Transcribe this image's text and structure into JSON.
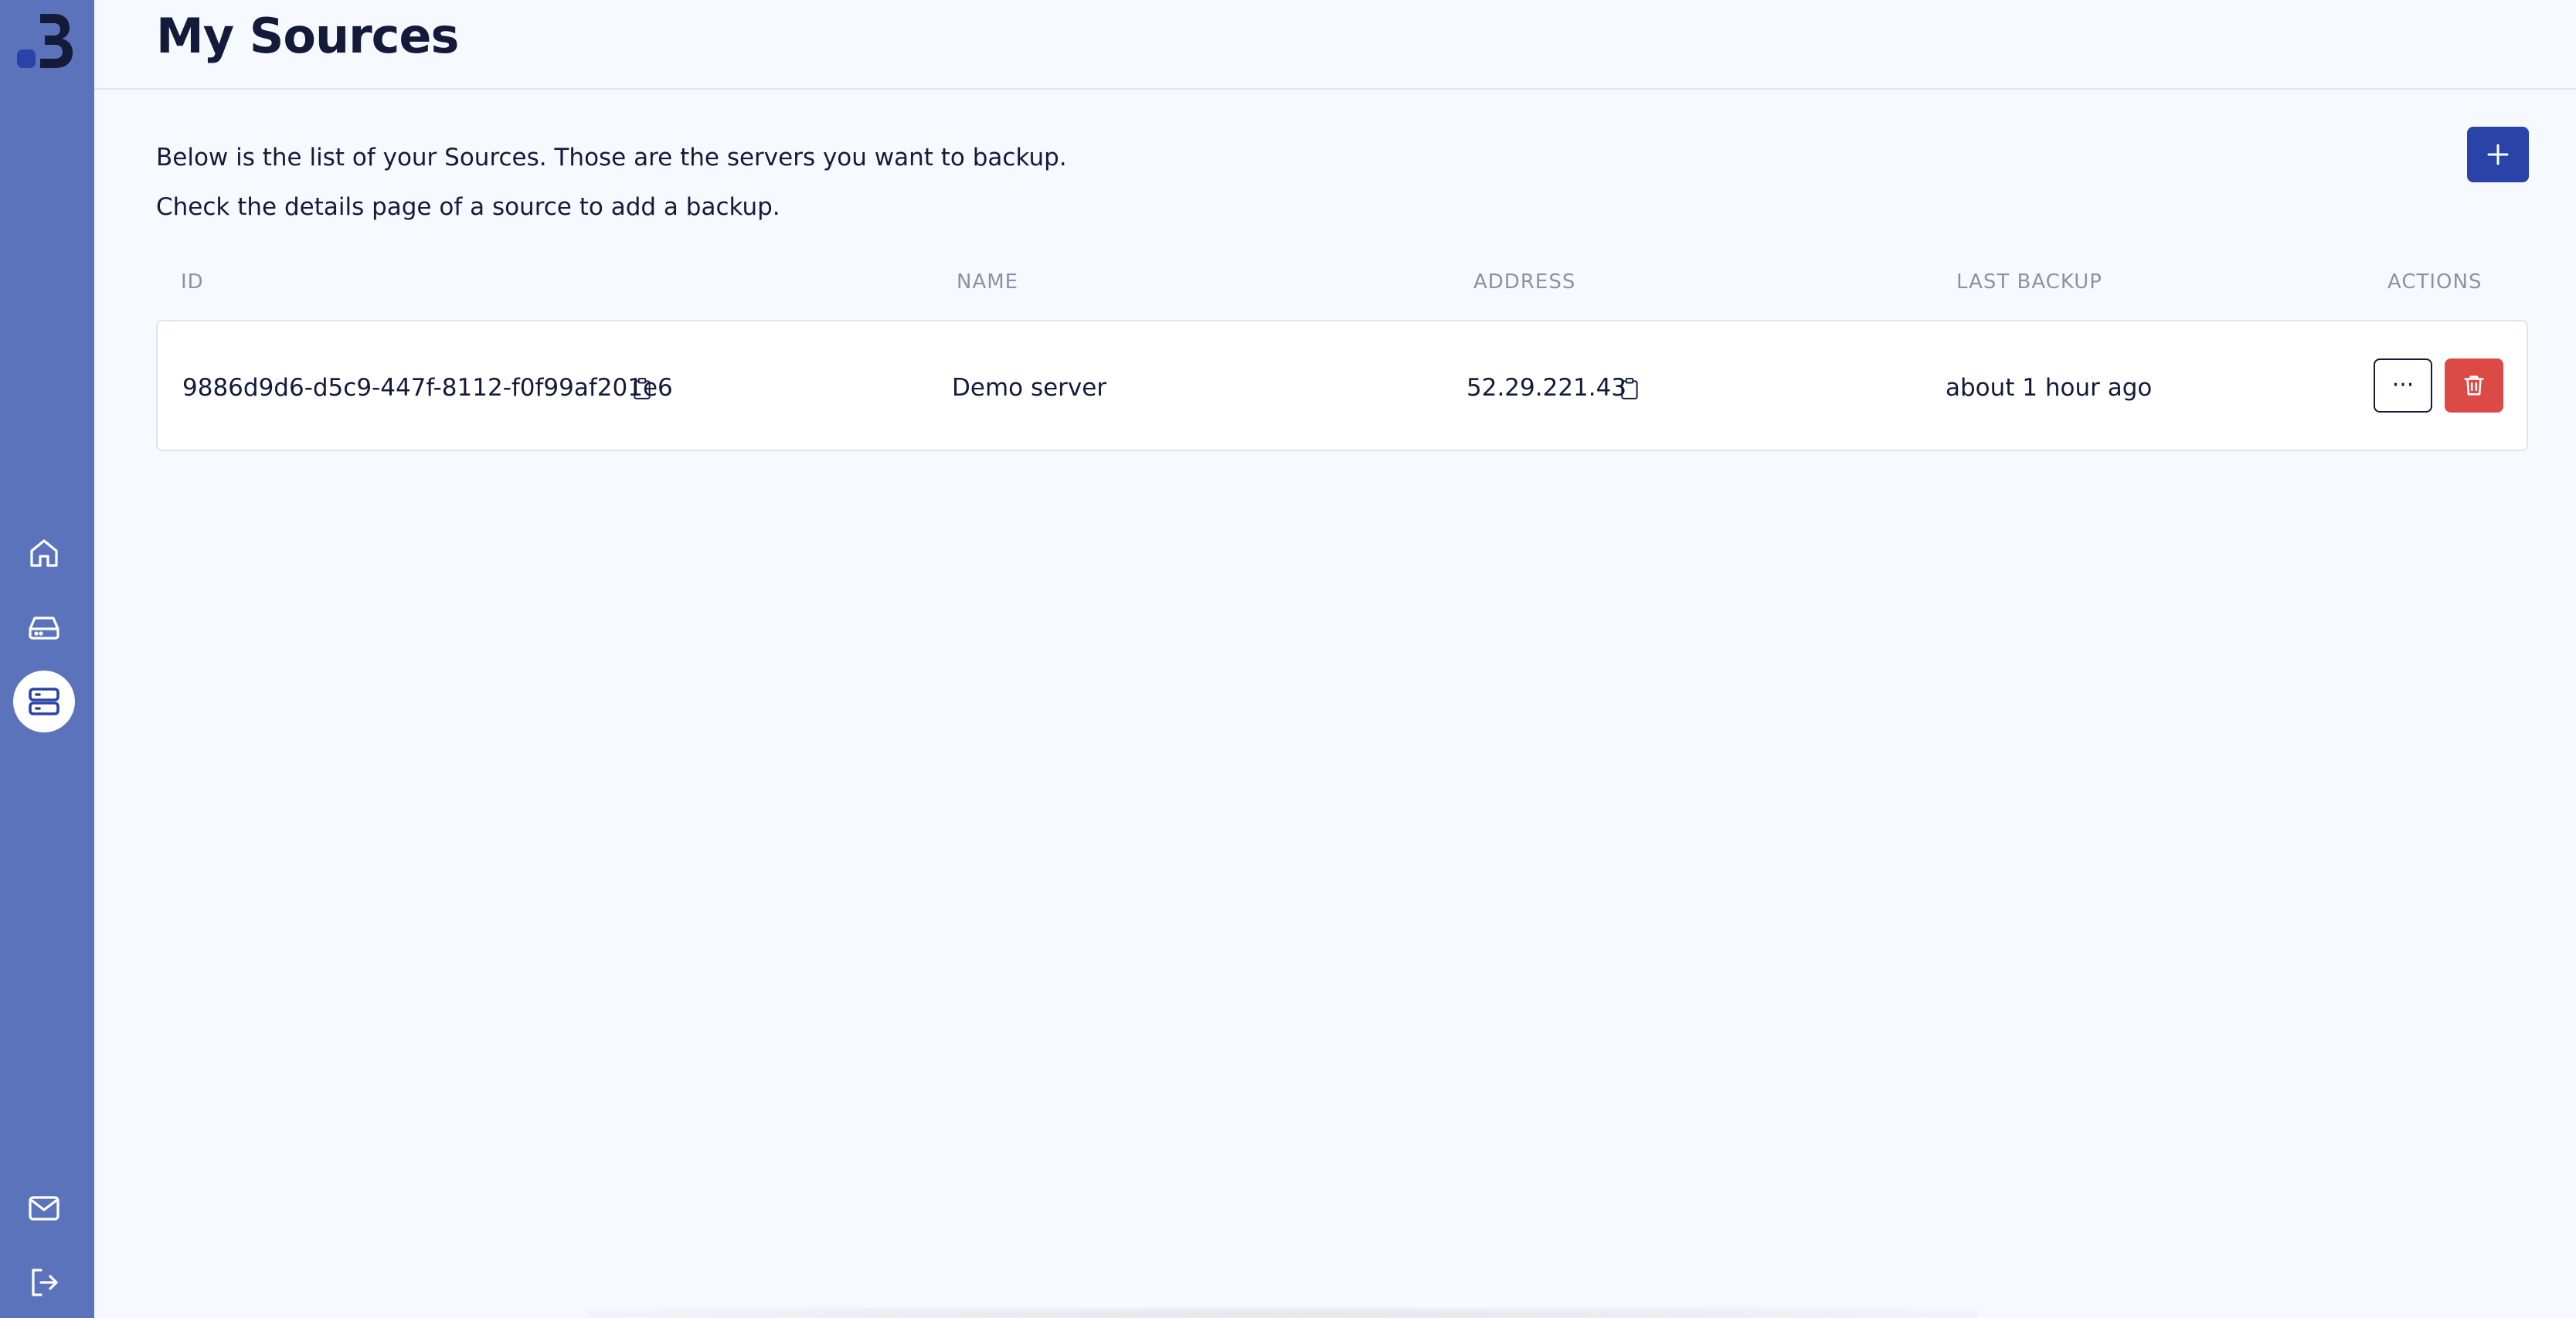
{
  "header": {
    "title": "My Sources"
  },
  "intro": {
    "line1": "Below is the list of your Sources. Those are the servers you want to backup.",
    "line2": "Check the details page of a source to add a backup."
  },
  "toolbar": {
    "add_icon": "plus-icon"
  },
  "sidebar": {
    "logo": "brand-logo",
    "items": [
      {
        "icon": "home-icon",
        "active": false
      },
      {
        "icon": "hard-drive-icon",
        "active": false
      },
      {
        "icon": "server-icon",
        "active": true
      },
      {
        "icon": "mail-icon",
        "active": false
      },
      {
        "icon": "logout-icon",
        "active": false
      }
    ]
  },
  "table": {
    "columns": [
      "ID",
      "NAME",
      "ADDRESS",
      "LAST BACKUP",
      "ACTIONS"
    ],
    "rows": [
      {
        "id": "9886d9d6-d5c9-447f-8112-f0f99af201e6",
        "name": "Demo server",
        "address": "52.29.221.43",
        "last_backup": "about 1 hour ago",
        "more_label": "···"
      }
    ]
  },
  "colors": {
    "sidebar": "#5b73bb",
    "primary": "#2a43a8",
    "danger": "#dc4a45",
    "background": "#f6f9fd",
    "text": "#141b3a"
  }
}
